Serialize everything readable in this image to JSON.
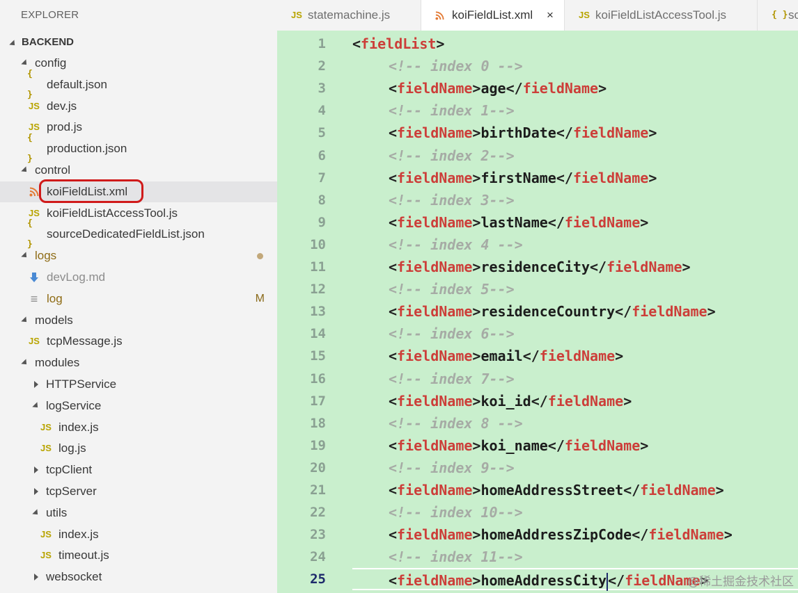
{
  "sidebar": {
    "title": "EXPLORER",
    "section": "BACKEND",
    "tree": [
      {
        "name": "config",
        "kind": "folder",
        "expanded": true
      },
      {
        "name": "default.json",
        "icon": "{}",
        "icon_name": "json-file-icon"
      },
      {
        "name": "dev.js",
        "icon": "JS",
        "icon_name": "js-file-icon"
      },
      {
        "name": "prod.js",
        "icon": "JS",
        "icon_name": "js-file-icon"
      },
      {
        "name": "production.json",
        "icon": "{}",
        "icon_name": "json-file-icon"
      },
      {
        "name": "control",
        "kind": "folder",
        "expanded": true
      },
      {
        "name": "koiFieldList.xml",
        "icon": "rss",
        "icon_name": "xml-file-icon",
        "selected": true
      },
      {
        "name": "koiFieldListAccessTool.js",
        "icon": "JS",
        "icon_name": "js-file-icon"
      },
      {
        "name": "sourceDedicatedFieldList.json",
        "icon": "{}",
        "icon_name": "json-file-icon"
      },
      {
        "name": "logs",
        "kind": "folder",
        "expanded": true,
        "status": "modified-dot"
      },
      {
        "name": "devLog.md",
        "icon": "arrow-down",
        "icon_name": "markdown-file-icon",
        "muted": true
      },
      {
        "name": "log",
        "icon": "lines",
        "icon_name": "text-file-icon",
        "badge": "M"
      },
      {
        "name": "models",
        "kind": "folder",
        "expanded": true
      },
      {
        "name": "tcpMessage.js",
        "icon": "JS",
        "icon_name": "js-file-icon"
      },
      {
        "name": "modules",
        "kind": "folder",
        "expanded": true
      },
      {
        "name": "HTTPService",
        "kind": "folder",
        "expanded": false
      },
      {
        "name": "logService",
        "kind": "folder",
        "expanded": true
      },
      {
        "name": "index.js",
        "icon": "JS",
        "icon_name": "js-file-icon"
      },
      {
        "name": "log.js",
        "icon": "JS",
        "icon_name": "js-file-icon"
      },
      {
        "name": "tcpClient",
        "kind": "folder",
        "expanded": false
      },
      {
        "name": "tcpServer",
        "kind": "folder",
        "expanded": false
      },
      {
        "name": "utils",
        "kind": "folder",
        "expanded": true
      },
      {
        "name": "index.js",
        "icon": "JS",
        "icon_name": "js-file-icon"
      },
      {
        "name": "timeout.js",
        "icon": "JS",
        "icon_name": "js-file-icon"
      },
      {
        "name": "websocket",
        "kind": "folder",
        "expanded": false
      }
    ]
  },
  "tabs": [
    {
      "label": "statemachine.js",
      "icon": "JS",
      "active": false
    },
    {
      "label": "koiFieldList.xml",
      "icon": "rss",
      "active": true,
      "close": "×"
    },
    {
      "label": "koiFieldListAccessTool.js",
      "icon": "JS",
      "active": false
    },
    {
      "label": "sc",
      "icon": "{}",
      "active": false
    }
  ],
  "editor": {
    "current_line": 25,
    "lines": [
      {
        "n": "1",
        "indent": 0,
        "tokens": [
          [
            "punct",
            "<"
          ],
          [
            "tagname",
            "fieldList"
          ],
          [
            "punct",
            ">"
          ]
        ]
      },
      {
        "n": "2",
        "indent": 1,
        "tokens": [
          [
            "comment",
            "<!-- index 0 -->"
          ]
        ]
      },
      {
        "n": "3",
        "indent": 1,
        "tokens": [
          [
            "punct",
            "<"
          ],
          [
            "tagname",
            "fieldName"
          ],
          [
            "punct",
            ">"
          ],
          [
            "text",
            "age"
          ],
          [
            "punct",
            "</"
          ],
          [
            "tagname",
            "fieldName"
          ],
          [
            "punct",
            ">"
          ]
        ]
      },
      {
        "n": "4",
        "indent": 1,
        "tokens": [
          [
            "comment",
            "<!-- index 1-->"
          ]
        ]
      },
      {
        "n": "5",
        "indent": 1,
        "tokens": [
          [
            "punct",
            "<"
          ],
          [
            "tagname",
            "fieldName"
          ],
          [
            "punct",
            ">"
          ],
          [
            "text",
            "birthDate"
          ],
          [
            "punct",
            "</"
          ],
          [
            "tagname",
            "fieldName"
          ],
          [
            "punct",
            ">"
          ]
        ]
      },
      {
        "n": "6",
        "indent": 1,
        "tokens": [
          [
            "comment",
            "<!-- index 2-->"
          ]
        ]
      },
      {
        "n": "7",
        "indent": 1,
        "tokens": [
          [
            "punct",
            "<"
          ],
          [
            "tagname",
            "fieldName"
          ],
          [
            "punct",
            ">"
          ],
          [
            "text",
            "firstName"
          ],
          [
            "punct",
            "</"
          ],
          [
            "tagname",
            "fieldName"
          ],
          [
            "punct",
            ">"
          ]
        ]
      },
      {
        "n": "8",
        "indent": 1,
        "tokens": [
          [
            "comment",
            "<!-- index 3-->"
          ]
        ]
      },
      {
        "n": "9",
        "indent": 1,
        "tokens": [
          [
            "punct",
            "<"
          ],
          [
            "tagname",
            "fieldName"
          ],
          [
            "punct",
            ">"
          ],
          [
            "text",
            "lastName"
          ],
          [
            "punct",
            "</"
          ],
          [
            "tagname",
            "fieldName"
          ],
          [
            "punct",
            ">"
          ]
        ]
      },
      {
        "n": "10",
        "indent": 1,
        "tokens": [
          [
            "comment",
            "<!-- index 4 -->"
          ]
        ]
      },
      {
        "n": "11",
        "indent": 1,
        "tokens": [
          [
            "punct",
            "<"
          ],
          [
            "tagname",
            "fieldName"
          ],
          [
            "punct",
            ">"
          ],
          [
            "text",
            "residenceCity"
          ],
          [
            "punct",
            "</"
          ],
          [
            "tagname",
            "fieldName"
          ],
          [
            "punct",
            ">"
          ]
        ]
      },
      {
        "n": "12",
        "indent": 1,
        "tokens": [
          [
            "comment",
            "<!-- index 5-->"
          ]
        ]
      },
      {
        "n": "13",
        "indent": 1,
        "tokens": [
          [
            "punct",
            "<"
          ],
          [
            "tagname",
            "fieldName"
          ],
          [
            "punct",
            ">"
          ],
          [
            "text",
            "residenceCountry"
          ],
          [
            "punct",
            "</"
          ],
          [
            "tagname",
            "fieldName"
          ],
          [
            "punct",
            ">"
          ]
        ]
      },
      {
        "n": "14",
        "indent": 1,
        "tokens": [
          [
            "comment",
            "<!-- index 6-->"
          ]
        ]
      },
      {
        "n": "15",
        "indent": 1,
        "tokens": [
          [
            "punct",
            "<"
          ],
          [
            "tagname",
            "fieldName"
          ],
          [
            "punct",
            ">"
          ],
          [
            "text",
            "email"
          ],
          [
            "punct",
            "</"
          ],
          [
            "tagname",
            "fieldName"
          ],
          [
            "punct",
            ">"
          ]
        ]
      },
      {
        "n": "16",
        "indent": 1,
        "tokens": [
          [
            "comment",
            "<!-- index 7-->"
          ]
        ]
      },
      {
        "n": "17",
        "indent": 1,
        "tokens": [
          [
            "punct",
            "<"
          ],
          [
            "tagname",
            "fieldName"
          ],
          [
            "punct",
            ">"
          ],
          [
            "text",
            "koi_id"
          ],
          [
            "punct",
            "</"
          ],
          [
            "tagname",
            "fieldName"
          ],
          [
            "punct",
            ">"
          ]
        ]
      },
      {
        "n": "18",
        "indent": 1,
        "tokens": [
          [
            "comment",
            "<!-- index 8 -->"
          ]
        ]
      },
      {
        "n": "19",
        "indent": 1,
        "tokens": [
          [
            "punct",
            "<"
          ],
          [
            "tagname",
            "fieldName"
          ],
          [
            "punct",
            ">"
          ],
          [
            "text",
            "koi_name"
          ],
          [
            "punct",
            "</"
          ],
          [
            "tagname",
            "fieldName"
          ],
          [
            "punct",
            ">"
          ]
        ]
      },
      {
        "n": "20",
        "indent": 1,
        "tokens": [
          [
            "comment",
            "<!-- index 9-->"
          ]
        ]
      },
      {
        "n": "21",
        "indent": 1,
        "tokens": [
          [
            "punct",
            "<"
          ],
          [
            "tagname",
            "fieldName"
          ],
          [
            "punct",
            ">"
          ],
          [
            "text",
            "homeAddressStreet"
          ],
          [
            "punct",
            "</"
          ],
          [
            "tagname",
            "fieldName"
          ],
          [
            "punct",
            ">"
          ]
        ]
      },
      {
        "n": "22",
        "indent": 1,
        "tokens": [
          [
            "comment",
            "<!-- index 10-->"
          ]
        ]
      },
      {
        "n": "23",
        "indent": 1,
        "tokens": [
          [
            "punct",
            "<"
          ],
          [
            "tagname",
            "fieldName"
          ],
          [
            "punct",
            ">"
          ],
          [
            "text",
            "homeAddressZipCode"
          ],
          [
            "punct",
            "</"
          ],
          [
            "tagname",
            "fieldName"
          ],
          [
            "punct",
            ">"
          ]
        ]
      },
      {
        "n": "24",
        "indent": 1,
        "tokens": [
          [
            "comment",
            "<!-- index 11-->"
          ]
        ]
      },
      {
        "n": "25",
        "indent": 1,
        "tokens": [
          [
            "punct",
            "<"
          ],
          [
            "tagname",
            "fieldName"
          ],
          [
            "punct",
            ">"
          ],
          [
            "text",
            "homeAddressCity"
          ],
          [
            "caret",
            ""
          ],
          [
            "punct",
            "</"
          ],
          [
            "tagname",
            "fieldName"
          ],
          [
            "punct",
            ">"
          ]
        ]
      }
    ]
  },
  "watermark": "@稀土掘金技术社区",
  "colors": {
    "editor_bg": "#c9efcd",
    "tag": "#cc3e39",
    "comment": "#a6aba5",
    "highlight_ring": "#d01a1a"
  }
}
